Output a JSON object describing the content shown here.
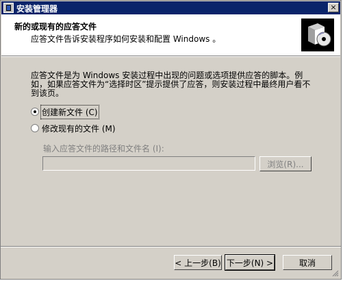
{
  "window": {
    "title": "安装管理器",
    "close_label": "×"
  },
  "header": {
    "title": "新的或现有的应答文件",
    "subtitle": "应答文件告诉安装程序如何安装和配置 Windows 。"
  },
  "content": {
    "description": "应答文件是为 Windows 安装过程中出现的问题或选项提供应答的脚本。例如，如果应答文件为“选择时区”提示提供了应答，则安装过程中最终用户看不到该页。",
    "options": [
      {
        "label": "创建新文件 (C)",
        "checked": true
      },
      {
        "label": "修改现有的文件 (M)",
        "checked": false
      }
    ],
    "path_label": "输入应答文件的路径和文件名 (I):",
    "path_value": "",
    "browse_label": "浏览(R)..."
  },
  "footer": {
    "back_label": "< 上一步(B)",
    "next_label": "下一步(N) >",
    "cancel_label": "取消"
  },
  "colors": {
    "titlebar": "#0a246a",
    "face": "#d4d0c8"
  }
}
